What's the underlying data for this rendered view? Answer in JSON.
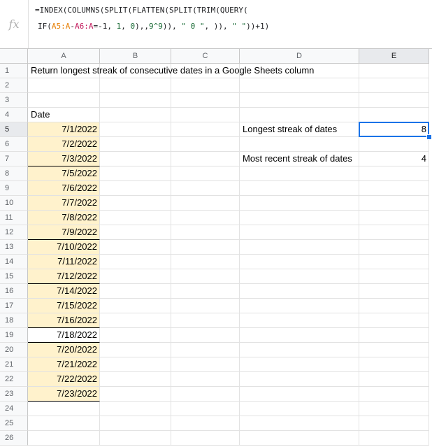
{
  "formula_bar": {
    "fx_label": "fx",
    "line1": "=INDEX(COLUMNS(SPLIT(FLATTEN(SPLIT(TRIM(QUERY(",
    "line2_parts": [
      "IF(",
      "A5:A",
      "-",
      "A6:A",
      "=-1, ",
      "1",
      ", ",
      "0",
      "),,",
      "9^9",
      ")), ",
      "\" 0 \"",
      ", )), ",
      "\" \"",
      "))+1)"
    ]
  },
  "columns": [
    "A",
    "B",
    "C",
    "D",
    "E"
  ],
  "rows": [
    "1",
    "2",
    "3",
    "4",
    "5",
    "6",
    "7",
    "8",
    "9",
    "10",
    "11",
    "12",
    "13",
    "14",
    "15",
    "16",
    "17",
    "18",
    "19",
    "20",
    "21",
    "22",
    "23",
    "24",
    "25",
    "26"
  ],
  "title": "Return longest streak of consecutive dates in a Google Sheets column",
  "date_header": "Date",
  "dates": [
    "7/1/2022",
    "7/2/2022",
    "7/3/2022",
    "7/5/2022",
    "7/6/2022",
    "7/7/2022",
    "7/8/2022",
    "7/9/2022",
    "7/10/2022",
    "7/11/2022",
    "7/12/2022",
    "7/14/2022",
    "7/15/2022",
    "7/16/2022",
    "7/18/2022",
    "7/20/2022",
    "7/21/2022",
    "7/22/2022",
    "7/23/2022"
  ],
  "labels": {
    "longest": "Longest streak of dates",
    "recent": "Most recent streak of dates"
  },
  "values": {
    "longest": "8",
    "recent": "4"
  },
  "colors": {
    "highlight": "#fff2cc",
    "selection": "#1a73e8"
  }
}
